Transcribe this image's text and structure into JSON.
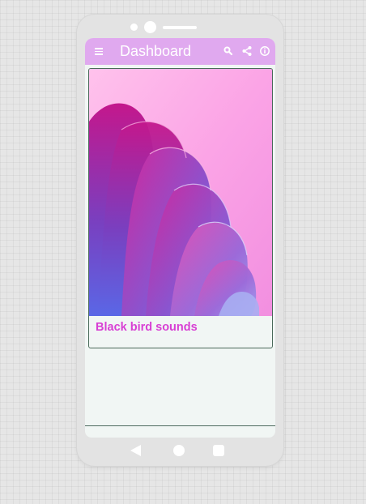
{
  "app": {
    "title": "Dashboard",
    "actions": [
      "search-icon",
      "share-icon",
      "info-icon"
    ],
    "menu_icon": "menu-icon"
  },
  "card": {
    "title": "Black bird sounds",
    "image": "abstract pink and purple wavy shapes"
  },
  "nav": {
    "buttons": [
      "back-icon",
      "home-icon",
      "recent-apps-icon"
    ]
  },
  "colors": {
    "appbar": "#e0a9ef",
    "card_title": "#d83fd4",
    "screen_background": "#f1f6f4",
    "phone_frame": "#e3e3e3"
  }
}
